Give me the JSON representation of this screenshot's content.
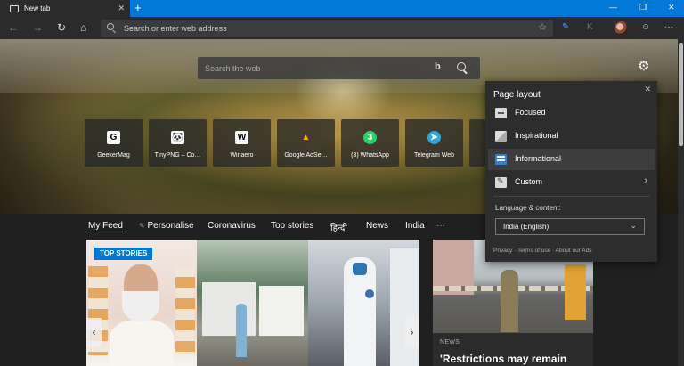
{
  "browser": {
    "tab_title": "New tab",
    "new_tab_glyph": "+",
    "window_controls": [
      "—",
      "❐",
      "✕"
    ],
    "address_placeholder": "Search or enter web address",
    "toolbar_icons": [
      "favorites-star-icon",
      "collections-icon",
      "extension-icon",
      "profile-avatar",
      "feedback-icon",
      "more-icon"
    ]
  },
  "newtab": {
    "search_placeholder": "Search the web",
    "quick_links": [
      {
        "label": "GeekerMag",
        "icon": "G",
        "icon_bg": "#ffffff",
        "icon_fg": "#000000"
      },
      {
        "label": "TinyPNG – Co…",
        "icon": "🐼",
        "icon_bg": "#ffffff",
        "icon_fg": "#333333"
      },
      {
        "label": "Winaero",
        "icon": "W",
        "icon_bg": "#ffffff",
        "icon_fg": "#000000"
      },
      {
        "label": "Google AdSe…",
        "icon": "▲",
        "icon_bg": "transparent",
        "icon_fg": "#f4b400"
      },
      {
        "label": "(3) WhatsApp",
        "icon": "3",
        "icon_bg": "#25d366",
        "icon_fg": "#ffffff"
      },
      {
        "label": "Telegram Web",
        "icon": "➤",
        "icon_bg": "#2ca5e0",
        "icon_fg": "#ffffff"
      }
    ],
    "feed_nav": [
      "My Feed",
      "Personalise",
      "Coronavirus",
      "Top stories",
      "हिन्दी",
      "News",
      "India",
      "···"
    ],
    "top_stories_badge": "TOP STORIES",
    "card": {
      "category": "NEWS",
      "headline": "'Restrictions may remain"
    }
  },
  "layout_panel": {
    "title": "Page layout",
    "options": [
      {
        "label": "Focused",
        "icon": "focused-icon",
        "selected": false
      },
      {
        "label": "Inspirational",
        "icon": "inspirational-icon",
        "selected": false
      },
      {
        "label": "Informational",
        "icon": "informational-icon",
        "selected": true
      },
      {
        "label": "Custom",
        "icon": "custom-icon",
        "selected": false
      }
    ],
    "language_label": "Language & content:",
    "language_value": "India (English)",
    "footer": [
      "Privacy",
      "·",
      "Terms of use",
      "·",
      "About our Ads"
    ]
  },
  "colors": {
    "accent": "#0078d7",
    "toolbar": "#2b2b2b",
    "page": "#202020"
  }
}
